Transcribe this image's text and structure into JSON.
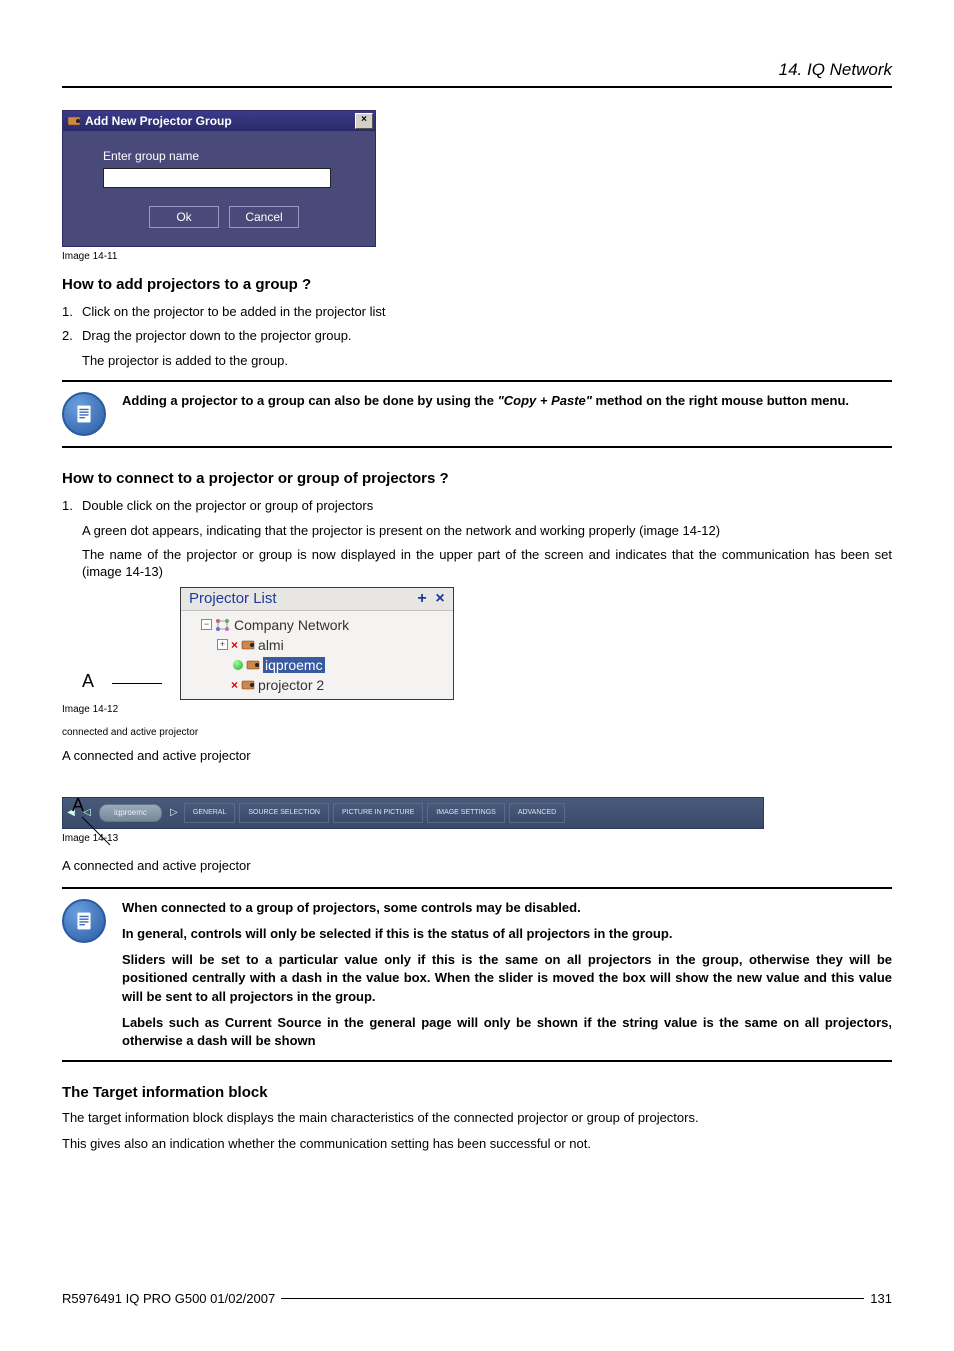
{
  "header": {
    "chapter": "14. IQ Network"
  },
  "dialog": {
    "title": "Add New Projector Group",
    "prompt": "Enter group name",
    "ok": "Ok",
    "cancel": "Cancel"
  },
  "captions": {
    "img11": "Image 14-11",
    "img12": "Image 14-12",
    "img12sub": "connected and active projector",
    "img13": "Image 14-13",
    "legendA_12": "A    connected and active projector",
    "legendA_13": "A    connected and active projector"
  },
  "sections": {
    "addToGroup": {
      "heading": "How to add projectors to a group ?",
      "step1": "Click on the projector to be added in the projector list",
      "step2": "Drag the projector down to the projector group.",
      "step2sub": "The projector is added to the group."
    },
    "connect": {
      "heading": "How to connect to a projector or group of projectors ?",
      "step1": "Double click on the projector or group of projectors",
      "step1sub1": "A green dot appears, indicating that the projector is present on the network and working properly (image 14-12)",
      "step1sub2": "The name of the projector or group is now displayed in the upper part of the screen and indicates that the communication has been set (image 14-13)"
    },
    "target": {
      "heading": "The Target information block",
      "p1": "The target information block displays the main characteristics of the connected projector or group of projectors.",
      "p2": "This gives also an indication whether the communication setting has been successful or not."
    }
  },
  "notes": {
    "copypaste_pre": "Adding a projector to a group can also be done by using the ",
    "copypaste_em": "\"Copy + Paste\"",
    "copypaste_post": " method on the right mouse button menu.",
    "group_p1": "When connected to a group of projectors, some controls may be disabled.",
    "group_p2": "In general, controls will only be selected if this is the status of all projectors in the group.",
    "group_p3": "Sliders will be set to a particular value only if this is the same on all projectors in the group, otherwise they will be positioned centrally with a dash in the value box. When the slider is moved the box will show the new value and this value will be sent to all projectors in the group.",
    "group_p4": "Labels such as Current Source in the general page will only be shown if the string value is the same on all projectors, otherwise a dash will be shown"
  },
  "projectorList": {
    "panelTitle": "Projector List",
    "root": "Company Network",
    "item1": "almi",
    "item2": "iqproemc",
    "item3": "projector 2",
    "letter": "A"
  },
  "toolbar": {
    "letter": "A",
    "pill": "iqproemc",
    "tabs": [
      "GENERAL",
      "SOURCE SELECTION",
      "PICTURE IN PICTURE",
      "IMAGE SETTINGS",
      "ADVANCED"
    ]
  },
  "footer": {
    "doc": "R5976491  IQ PRO G500  01/02/2007",
    "page": "131"
  }
}
